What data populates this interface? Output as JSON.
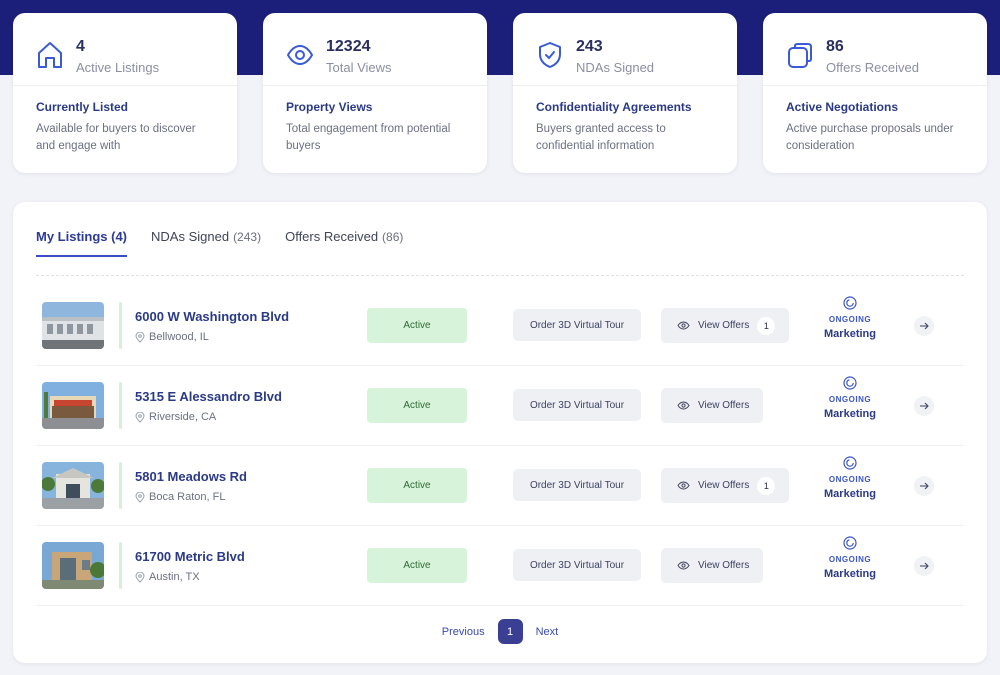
{
  "stats": [
    {
      "icon": "home-icon",
      "value": "4",
      "label": "Active Listings",
      "title": "Currently Listed",
      "desc": "Available for buyers to discover and engage with"
    },
    {
      "icon": "eye-icon",
      "value": "12324",
      "label": "Total Views",
      "title": "Property Views",
      "desc": "Total engagement from potential buyers"
    },
    {
      "icon": "shield-check-icon",
      "value": "243",
      "label": "NDAs Signed",
      "title": "Confidentiality Agreements",
      "desc": "Buyers granted access to confidential information"
    },
    {
      "icon": "offer-document-icon",
      "value": "86",
      "label": "Offers Received",
      "title": "Active Negotiations",
      "desc": "Active purchase proposals under consideration"
    }
  ],
  "tabs": [
    {
      "label": "My Listings (4)",
      "count": ""
    },
    {
      "label": "NDAs Signed",
      "count": "(243)"
    },
    {
      "label": "Offers Received",
      "count": "(86)"
    }
  ],
  "listings": [
    {
      "address": "6000 W Washington Blvd",
      "city": "Bellwood, IL",
      "status": "Active",
      "tour": "Order 3D Virtual Tour",
      "offers": "View Offers",
      "offer_count": "1",
      "ongoing": "ONGOING",
      "stage": "Marketing"
    },
    {
      "address": "5315 E Alessandro Blvd",
      "city": "Riverside, CA",
      "status": "Active",
      "tour": "Order 3D Virtual Tour",
      "offers": "View Offers",
      "offer_count": "",
      "ongoing": "ONGOING",
      "stage": "Marketing"
    },
    {
      "address": "5801 Meadows Rd",
      "city": "Boca Raton, FL",
      "status": "Active",
      "tour": "Order 3D Virtual Tour",
      "offers": "View Offers",
      "offer_count": "1",
      "ongoing": "ONGOING",
      "stage": "Marketing"
    },
    {
      "address": "61700 Metric Blvd",
      "city": "Austin, TX",
      "status": "Active",
      "tour": "Order 3D Virtual Tour",
      "offers": "View Offers",
      "offer_count": "",
      "ongoing": "ONGOING",
      "stage": "Marketing"
    }
  ],
  "pagination": {
    "previous": "Previous",
    "current": "1",
    "next": "Next"
  },
  "colors": {
    "header_band": "#1c1f7a",
    "accent": "#3b4bc8",
    "status_active_bg": "#d7f3d9",
    "page_active": "#3a3f94"
  }
}
